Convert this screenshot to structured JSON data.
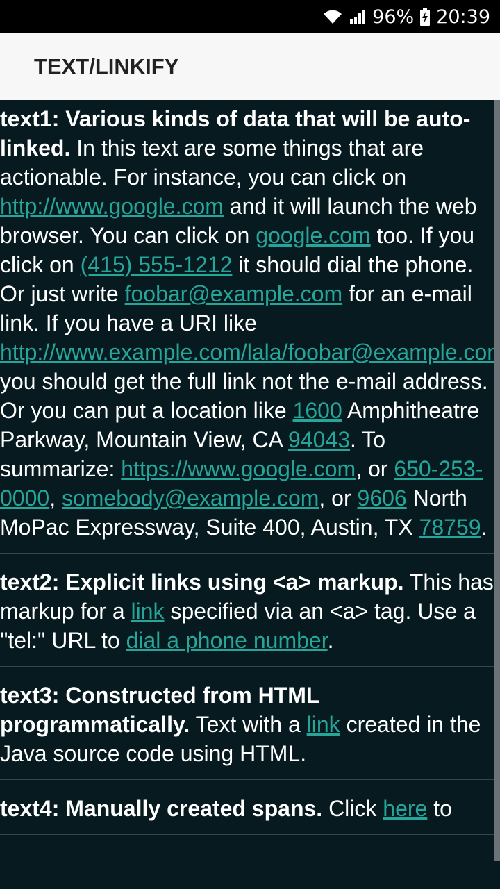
{
  "status_bar": {
    "battery": "96%",
    "time": "20:39",
    "icons": [
      "wifi-icon",
      "signal-icon",
      "battery-charging-icon"
    ]
  },
  "app_bar": {
    "title": "TEXT/LINKIFY"
  },
  "colors": {
    "link": "#26a69a",
    "background": "#061a1f",
    "app_bar": "#f7f7f7"
  },
  "sections": [
    {
      "heading": "text1: Various kinds of data that will be auto-linked.",
      "t1": " In this text are some things that are actionable. For instance, you can click on ",
      "l1": "http://www.google.com",
      "t2": " and it will launch the web browser. You can click on ",
      "l2": "google.com",
      "t3": " too. If you click on ",
      "l3": "(415) 555-1212",
      "t4": " it should dial the phone. Or just write ",
      "l4": "foobar@example.com",
      "t5": " for an e-mail link. If you have a URI like ",
      "l5": "http://www.example.com/lala/foobar@example.com",
      "t6": " you should get the full link not the e-mail address. Or you can put a location like ",
      "l6": "1600",
      "t7": " Amphitheatre Parkway, Mountain View, CA ",
      "l7": "94043",
      "t8": ". To summarize: ",
      "l8": "https://www.google.com",
      "t9": ", or ",
      "l9": "650-253-0000",
      "t10": ", ",
      "l10": "somebody@example.com",
      "t11": ", or ",
      "l11": "9606",
      "t12": " North MoPac Expressway, Suite 400, Austin, TX ",
      "l12": "78759",
      "t13": "."
    },
    {
      "heading": "text2: Explicit links using <a> markup.",
      "t1": " This has markup for a ",
      "l1": "link",
      "t2": " specified via an <a> tag. Use a \"tel:\" URL to ",
      "l2": "dial a phone number",
      "t3": "."
    },
    {
      "heading": "text3: Constructed from HTML programmatically.",
      "t1": " Text with a ",
      "l1": "link",
      "t2": " created in the Java source code using HTML."
    },
    {
      "heading": "text4: Manually created spans.",
      "t1": " Click ",
      "l1": "here",
      "t2": " to"
    }
  ]
}
